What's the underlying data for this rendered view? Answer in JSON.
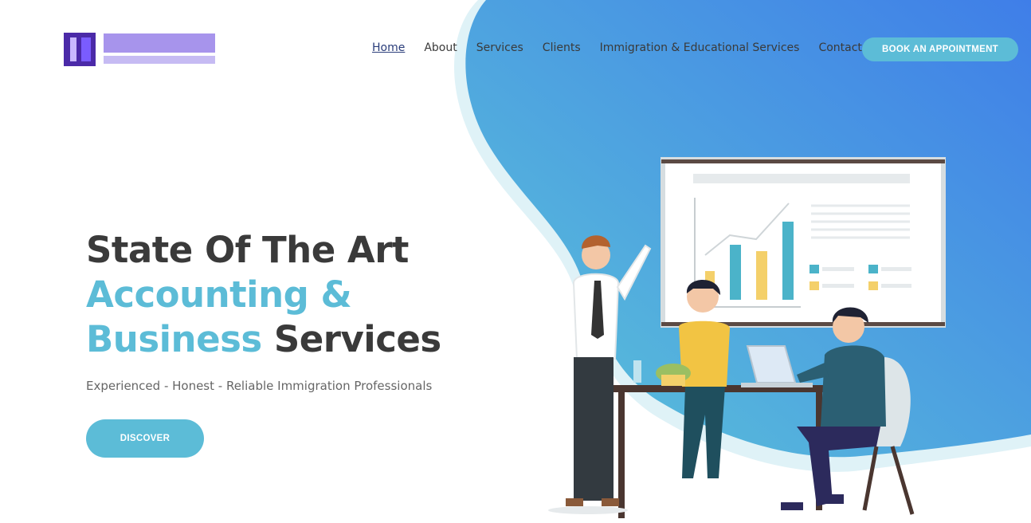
{
  "nav": {
    "items": [
      "Home",
      "About",
      "Services",
      "Clients",
      "Immigration & Educational Services",
      "Contact"
    ],
    "active": "Home"
  },
  "header": {
    "book_label": "BOOK AN APPOINTMENT"
  },
  "hero": {
    "line1": "State Of The Art",
    "line2_accent": "Accounting &",
    "line3_accent": "Business",
    "line3_rest": " Services",
    "subtitle": "Experienced - Honest - Reliable Immigration Professionals",
    "discover_label": "DISCOVER"
  },
  "colors": {
    "accent": "#5cbcd7",
    "blob_start": "#5cc3d6",
    "blob_end": "#3f7fe8"
  },
  "icons": {
    "logo": "company-logo",
    "illustration": "office-meeting-illustration"
  }
}
